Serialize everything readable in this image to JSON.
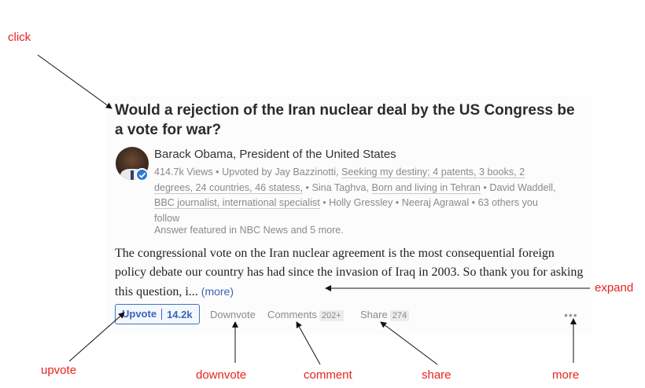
{
  "question": {
    "title": "Would a rejection of the Iran nuclear deal by the US Congress be a vote for war?"
  },
  "answer": {
    "author": "Barack Obama, President of the United States",
    "meta": {
      "views": "414.7k Views",
      "sep": " • ",
      "upvoted_by": "Upvoted by Jay Bazzinotti,",
      "cred1": "Seeking my destiny; 4 patents, 3 books, 2 degrees, 24 countries, 46 statess,",
      "voter2": "Sina Taghva,",
      "cred2": "Born and living in Tehran",
      "voter3": "David Waddell,",
      "cred3": "BBC journalist, international specialist",
      "voter4": "Holly Gressley",
      "voter5": "Neeraj Agrawal",
      "others": "63 others you follow"
    },
    "featured": "Answer featured in NBC News and 5 more.",
    "text": "The congressional vote on the Iran nuclear agreement is the most consequential foreign policy debate our country has had since the invasion of Iraq in 2003. So thank you for asking this question, i...",
    "more_label": "(more)"
  },
  "actions": {
    "upvote_label": "Upvote",
    "upvote_count": "14.2k",
    "downvote_label": "Downvote",
    "comments_label": "Comments",
    "comments_count": "202+",
    "share_label": "Share",
    "share_count": "274",
    "more_label": "•••"
  },
  "annotations": {
    "click": "click",
    "expand": "expand",
    "upvote": "upvote",
    "downvote": "downvote",
    "comment": "comment",
    "share": "share",
    "more": "more"
  },
  "colors": {
    "link": "#3b64b5",
    "annotation": "#e8231f",
    "verified": "#2b7bd6"
  },
  "icons": {
    "verified": "verified-check-icon",
    "more": "more-dots-icon"
  }
}
